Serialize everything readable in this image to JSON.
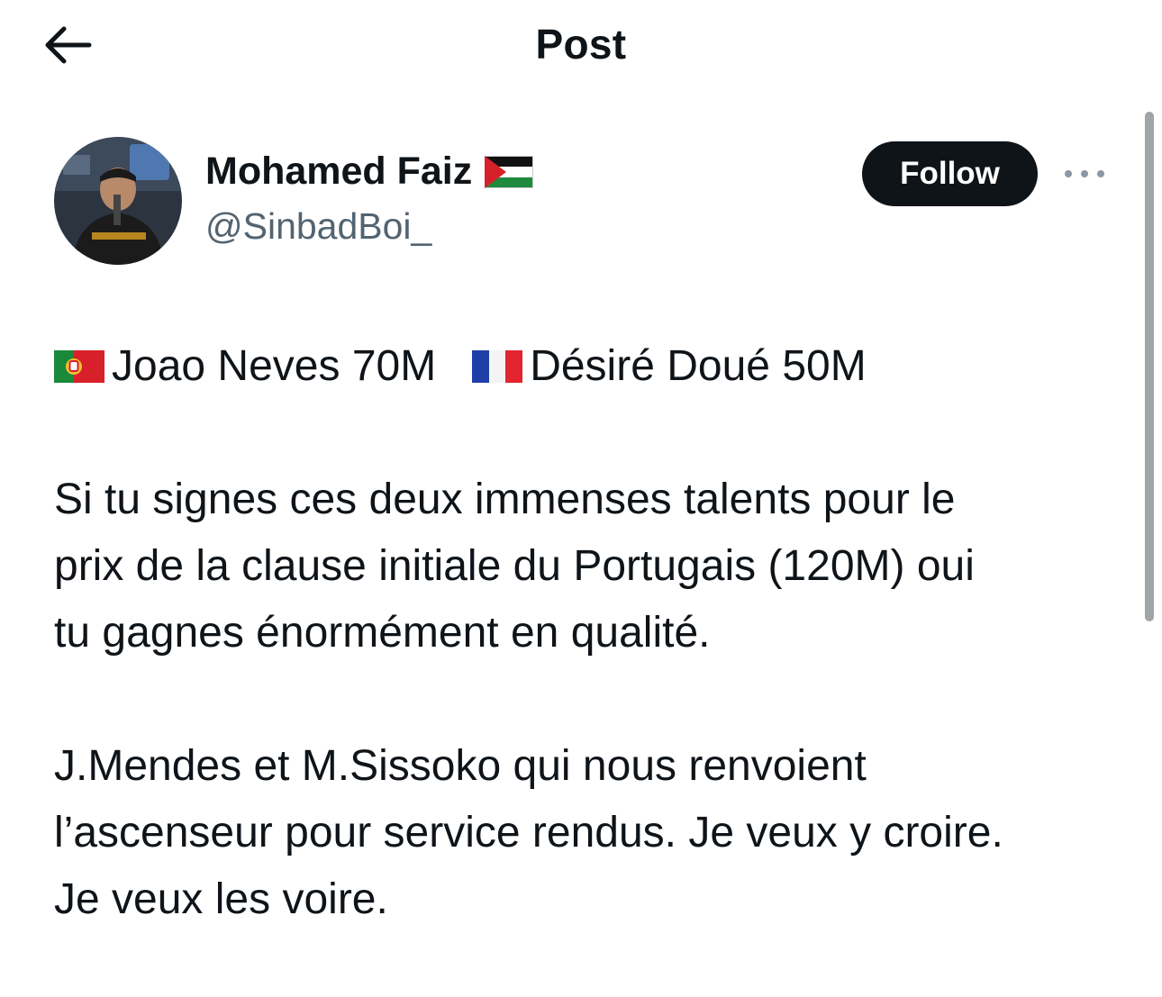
{
  "header": {
    "title": "Post",
    "back_icon": "arrow-left-icon"
  },
  "author": {
    "display_name": "Mohamed Faiz",
    "name_flag": "palestine-flag-icon",
    "handle": "@SinbadBoi_"
  },
  "actions": {
    "follow_label": "Follow",
    "more_icon": "more-horizontal-icon"
  },
  "tweet": {
    "line1_part1": "Joao Neves 70M",
    "line1_part2": "Désiré Doué 50M",
    "paragraph2_line1": "Si tu signes ces deux immenses talents pour le",
    "paragraph2_line2": "prix de la clause initiale du Portugais (120M) oui",
    "paragraph2_line3": "tu gagnes énormément en qualité.",
    "paragraph3_line1": "J.Mendes et M.Sissoko qui nous renvoient",
    "paragraph3_line2": "l’ascenseur pour service rendus. Je veux y croire.",
    "paragraph3_line3": "Je veux les voire."
  },
  "colors": {
    "text": "#0f1419",
    "secondary": "#536471",
    "follow_bg": "#0f1419"
  }
}
